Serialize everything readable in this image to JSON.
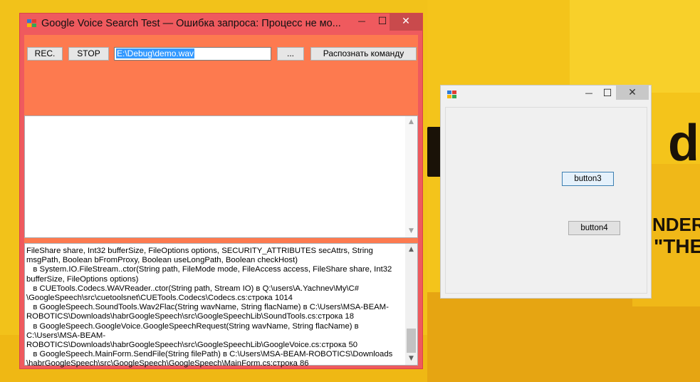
{
  "main_window": {
    "title": "Google Voice Search Test —  Ошибка запроса: Процесс не мо...",
    "controls": {
      "minimize": "—",
      "maximize": "☐",
      "close": "✕"
    },
    "rec_label": "REC.",
    "stop_label": "STOP",
    "path_value": "E:\\Debug\\demo.wav",
    "browse_label": "...",
    "recognize_label": "Распознать команду",
    "output_text": "",
    "log_text": "FileShare share, Int32 bufferSize, FileOptions options, SECURITY_ATTRIBUTES secAttrs, String msgPath, Boolean bFromProxy, Boolean useLongPath, Boolean checkHost)\n   в System.IO.FileStream..ctor(String path, FileMode mode, FileAccess access, FileShare share, Int32 bufferSize, FileOptions options)\n   в CUETools.Codecs.WAVReader..ctor(String path, Stream IO) в Q:\\users\\A.Yachnev\\My\\C# \\GoogleSpeech\\src\\cuetoolsnet\\CUETools.Codecs\\Codecs.cs:строка 1014\n   в GoogleSpeech.SoundTools.Wav2Flac(String wavName, String flacName) в C:\\Users\\MSA-BEAM-ROBOTICS\\Downloads\\habrGoogleSpeech\\src\\GoogleSpeechLib\\SoundTools.cs:строка 18\n   в GoogleSpeech.GoogleVoice.GoogleSpeechRequest(String wavName, String flacName) в C:\\Users\\MSA-BEAM-ROBOTICS\\Downloads\\habrGoogleSpeech\\src\\GoogleSpeechLib\\GoogleVoice.cs:строка 50\n   в GoogleSpeech.MainForm.SendFile(String filePath) в C:\\Users\\MSA-BEAM-ROBOTICS\\Downloads \\habrGoogleSpeech\\src\\GoogleSpeech\\GoogleSpeech\\MainForm.cs:строка 86"
  },
  "second_window": {
    "title": "",
    "controls": {
      "minimize": "—",
      "maximize": "☐",
      "close": "✕"
    },
    "button3_label": "button3",
    "button4_label": "button4"
  },
  "wallpaper": {
    "text_d": "d",
    "text_nder": "NDER",
    "text_the": "\"THE"
  },
  "colors": {
    "main_frame": "#ef5a5e",
    "main_client": "#fd7a4f",
    "wallpaper": "#f2c21a",
    "selection": "#3399ff"
  },
  "icons": [
    "app-icon",
    "minimize-icon",
    "maximize-icon",
    "close-icon",
    "scroll-up-arrow-icon",
    "scroll-down-arrow-icon"
  ]
}
